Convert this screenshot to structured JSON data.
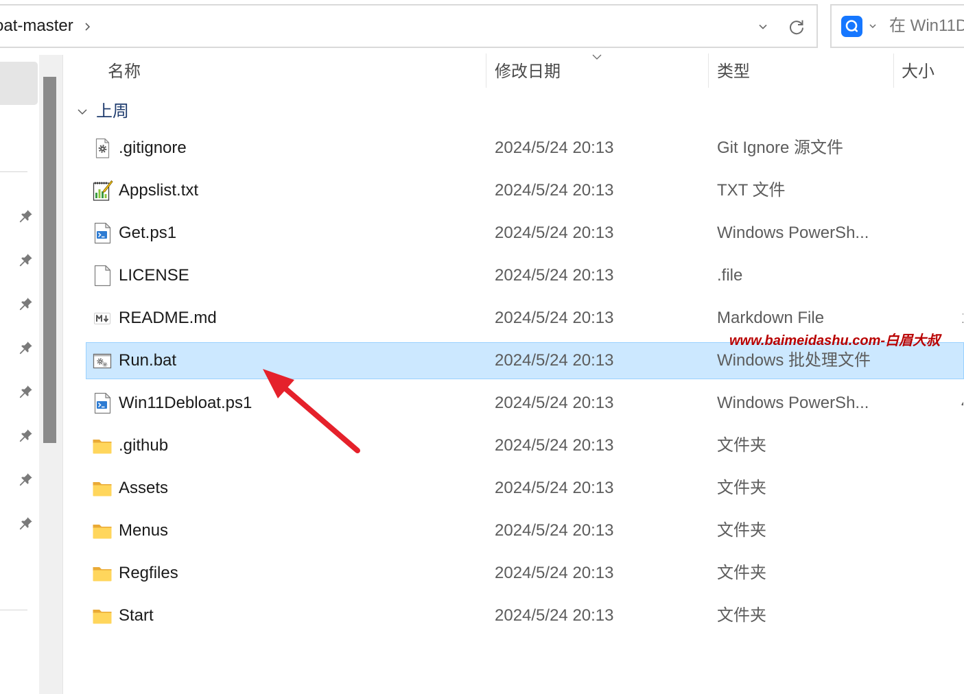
{
  "address_bar": {
    "path_segment": "oat-master"
  },
  "search": {
    "placeholder": "在 Win11D"
  },
  "columns": {
    "name": "名称",
    "modified": "修改日期",
    "type": "类型",
    "size": "大小"
  },
  "group": {
    "label": "上周"
  },
  "files": [
    {
      "name": ".gitignore",
      "modified": "2024/5/24 20:13",
      "type": "Git Ignore 源文件",
      "icon": "gear-file-icon"
    },
    {
      "name": "Appslist.txt",
      "modified": "2024/5/24 20:13",
      "type": "TXT 文件",
      "icon": "notepad-file-icon"
    },
    {
      "name": "Get.ps1",
      "modified": "2024/5/24 20:13",
      "type": "Windows PowerSh...",
      "icon": "powershell-file-icon"
    },
    {
      "name": "LICENSE",
      "modified": "2024/5/24 20:13",
      "type": ".file",
      "icon": "blank-file-icon"
    },
    {
      "name": "README.md",
      "modified": "2024/5/24 20:13",
      "type": "Markdown File",
      "size": "1",
      "icon": "markdown-file-icon"
    },
    {
      "name": "Run.bat",
      "modified": "2024/5/24 20:13",
      "type": "Windows 批处理文件",
      "icon": "batch-file-icon",
      "selected": true
    },
    {
      "name": "Win11Debloat.ps1",
      "modified": "2024/5/24 20:13",
      "type": "Windows PowerSh...",
      "size": "4",
      "icon": "powershell-file-icon"
    },
    {
      "name": ".github",
      "modified": "2024/5/24 20:13",
      "type": "文件夹",
      "icon": "folder-icon"
    },
    {
      "name": "Assets",
      "modified": "2024/5/24 20:13",
      "type": "文件夹",
      "icon": "folder-icon"
    },
    {
      "name": "Menus",
      "modified": "2024/5/24 20:13",
      "type": "文件夹",
      "icon": "folder-icon"
    },
    {
      "name": "Regfiles",
      "modified": "2024/5/24 20:13",
      "type": "文件夹",
      "icon": "folder-icon"
    },
    {
      "name": "Start",
      "modified": "2024/5/24 20:13",
      "type": "文件夹",
      "icon": "folder-icon"
    }
  ],
  "watermark": "www.baimeidashu.com-白眉大叔",
  "icons": {
    "breadcrumb_separator": "chevron-right-icon",
    "address_dropdown": "chevron-down-icon",
    "refresh": "refresh-icon",
    "search": "search-icon",
    "search_scope": "chevron-down-icon",
    "sort": "chevron-down-icon",
    "group_toggle": "chevron-down-icon",
    "nav_pin": "pin-icon",
    "annotation": "red-arrow"
  },
  "colors": {
    "selection_bg": "#cce8ff",
    "selection_border": "#99d1ff",
    "group_header": "#1f3c6e",
    "watermark": "#b80000",
    "annotation_arrow": "#e5212b",
    "search_icon_bg": "#1677ff",
    "folder": "#ffd65c",
    "folder_back": "#eaaa36",
    "scroll_thumb": "#8a8a8a"
  }
}
